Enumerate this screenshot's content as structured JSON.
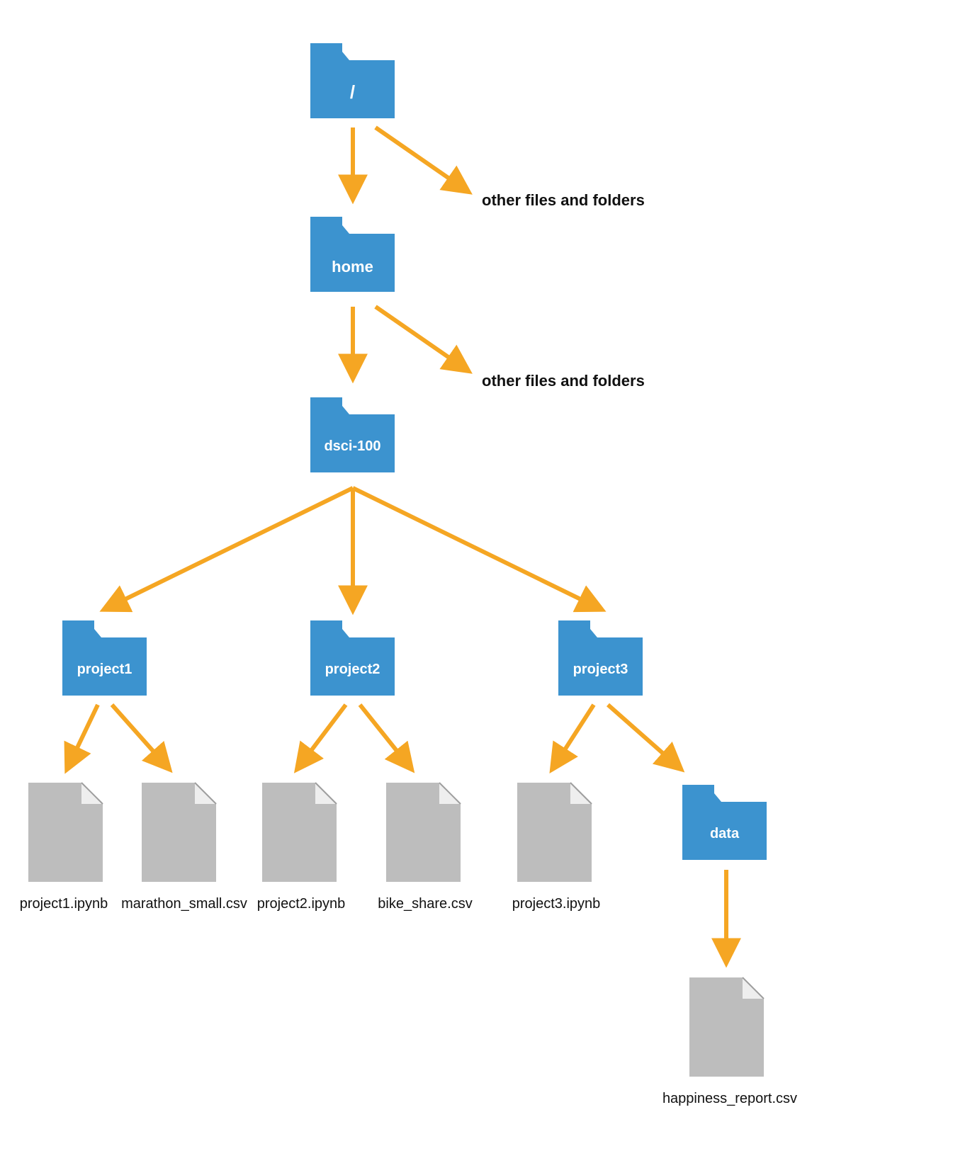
{
  "colors": {
    "folder": "#3C93CF",
    "arrow": "#F5A623",
    "file_fill": "#BDBDBD",
    "file_stroke": "#9E9E9E"
  },
  "side_labels": {
    "other1": "other files and folders",
    "other2": "other files and folders"
  },
  "folders": {
    "root": "/",
    "home": "home",
    "dsci100": "dsci-100",
    "project1": "project1",
    "project2": "project2",
    "project3": "project3",
    "data": "data"
  },
  "files": {
    "p1_nb": "project1.ipynb",
    "p1_csv": "marathon_small.csv",
    "p2_nb": "project2.ipynb",
    "p2_csv": "bike_share.csv",
    "p3_nb": "project3.ipynb",
    "data_csv": "happiness_report.csv"
  }
}
